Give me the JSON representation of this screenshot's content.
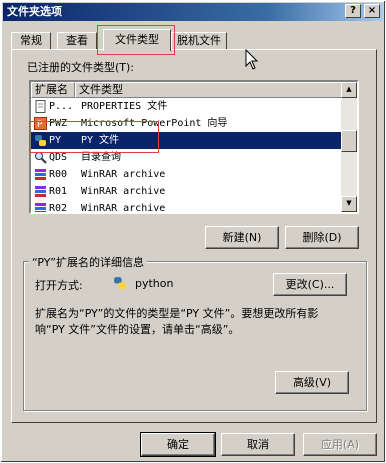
{
  "window": {
    "title": "文件夹选项",
    "help_label": "?",
    "close_label": "×"
  },
  "tabs": [
    {
      "label": "常规"
    },
    {
      "label": "查看"
    },
    {
      "label": "文件类型"
    },
    {
      "label": "脱机文件"
    }
  ],
  "registered": {
    "label": "已注册的文件类型(T):",
    "columns": [
      "扩展名",
      "文件类型"
    ],
    "rows": [
      {
        "ext": "P...",
        "type": "PROPERTIES 文件",
        "icon": "document-icon"
      },
      {
        "ext": "PWZ",
        "type": "Microsoft PowerPoint 向导",
        "icon": "powerpoint-icon"
      },
      {
        "ext": "PY",
        "type": "PY 文件",
        "icon": "python-icon",
        "selected": true
      },
      {
        "ext": "QDS",
        "type": "目录查询",
        "icon": "query-icon"
      },
      {
        "ext": "R00",
        "type": "WinRAR archive",
        "icon": "winrar-icon"
      },
      {
        "ext": "R01",
        "type": "WinRAR archive",
        "icon": "winrar-icon"
      },
      {
        "ext": "R02",
        "type": "WinRAR archive",
        "icon": "winrar-icon"
      }
    ]
  },
  "buttons": {
    "new": "新建(N)",
    "delete": "删除(D)",
    "change": "更改(C)...",
    "advanced": "高级(V)",
    "ok": "确定",
    "cancel": "取消",
    "apply": "应用(A)"
  },
  "details": {
    "title": "“PY”扩展名的详细信息",
    "opens_with_label": "打开方式:",
    "opens_with_app": "python",
    "description": "扩展名为“PY”的文件的类型是“PY 文件”。要想更改所有影响“PY 文件”文件的设置，请单击“高级”。"
  },
  "colors": {
    "selection": "#0a246a",
    "titlebar": "#0a246a",
    "highlight_box": "#e04040"
  }
}
